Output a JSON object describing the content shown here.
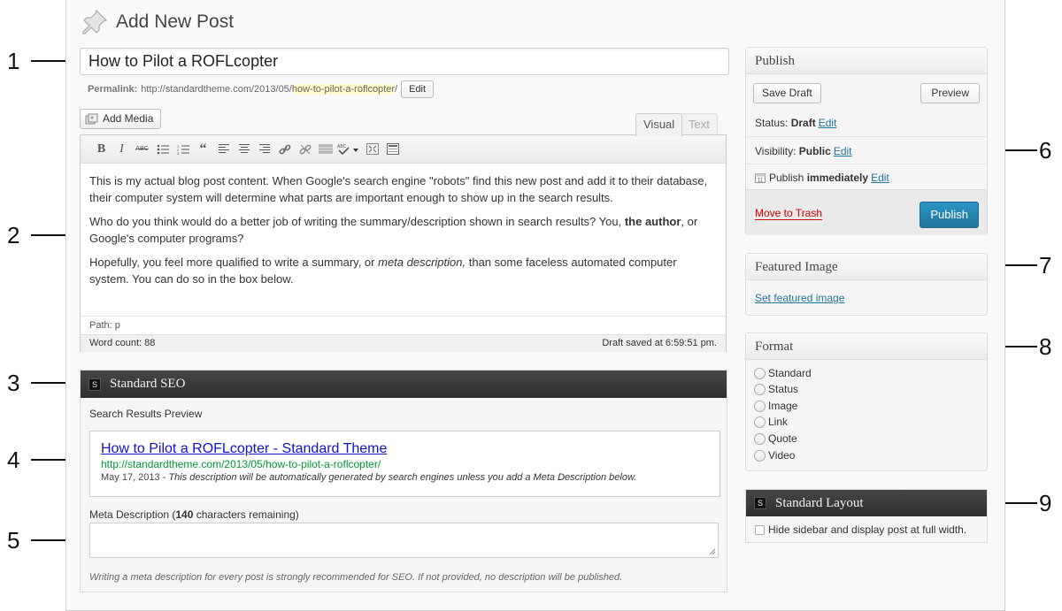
{
  "page": {
    "title": "Add New Post"
  },
  "post": {
    "title": "How to Pilot a ROFLcopter"
  },
  "permalink": {
    "label": "Permalink:",
    "base": "http://standardtheme.com/2013/05/",
    "slug": "how-to-pilot-a-roflcopter",
    "trailing": "/",
    "edit_label": "Edit"
  },
  "editor": {
    "add_media_label": "Add Media",
    "tabs": [
      {
        "label": "Visual"
      },
      {
        "label": "Text"
      }
    ],
    "toolbar_icons": [
      "bold-icon",
      "italic-icon",
      "strikethrough-icon",
      "bullet-list-icon",
      "numbered-list-icon",
      "blockquote-icon",
      "align-left-icon",
      "align-center-icon",
      "align-right-icon",
      "insert-link-icon",
      "unlink-icon",
      "read-more-icon",
      "spellcheck-icon",
      "fullscreen-icon",
      "kitchen-sink-icon"
    ],
    "paragraphs": [
      {
        "text": "This is my actual blog post content. When Google's search engine \"robots\" find this new post and add it to their database, their computer system will determine what parts are important enough to show up in the search results."
      },
      {
        "before": "Who do you think would do a better job of writing the summary/description shown in search results? You, ",
        "bold": "the author",
        "after": ", or Google's computer programs?"
      },
      {
        "before": "Hopefully, you feel more qualified to write a summary, or ",
        "italic": "meta description,",
        "after": " than some faceless automated computer system. You can do so in the box below."
      }
    ],
    "path": "Path: p",
    "word_count": "Word count: 88",
    "draft_saved": "Draft saved at 6:59:51 pm."
  },
  "seo": {
    "title": "Standard SEO",
    "badge": "S",
    "preview_label": "Search Results Preview",
    "preview": {
      "title": "How to Pilot a ROFLcopter - Standard Theme",
      "url": "http://standardtheme.com/2013/05/how-to-pilot-a-roflcopter/",
      "date": "May 17, 2013 - ",
      "description": "This description will be automatically generated by search engines unless you add a Meta Description below."
    },
    "meta_label_before": "Meta Description (",
    "meta_count": "140",
    "meta_label_after": " characters remaining)",
    "meta_value": "",
    "help": "Writing a meta description for every post is strongly recommended for SEO. If not provided, no description will be published."
  },
  "publish": {
    "title": "Publish",
    "save_draft": "Save Draft",
    "preview": "Preview",
    "status_label": "Status: ",
    "status_value": "Draft",
    "visibility_label": "Visibility: ",
    "visibility_value": "Public",
    "schedule_label": "Publish ",
    "schedule_value": "immediately",
    "edit_label": "Edit",
    "trash": "Move to Trash",
    "publish_btn": "Publish",
    "accent": "#21759b"
  },
  "featured": {
    "title": "Featured Image",
    "link": "Set featured image"
  },
  "format": {
    "title": "Format",
    "options": [
      "Standard",
      "Status",
      "Image",
      "Link",
      "Quote",
      "Video"
    ]
  },
  "layout": {
    "title": "Standard Layout",
    "badge": "S",
    "checkbox_label": "Hide sidebar and display post at full width."
  },
  "callouts": [
    "1",
    "2",
    "3",
    "4",
    "5",
    "6",
    "7",
    "8",
    "9"
  ]
}
